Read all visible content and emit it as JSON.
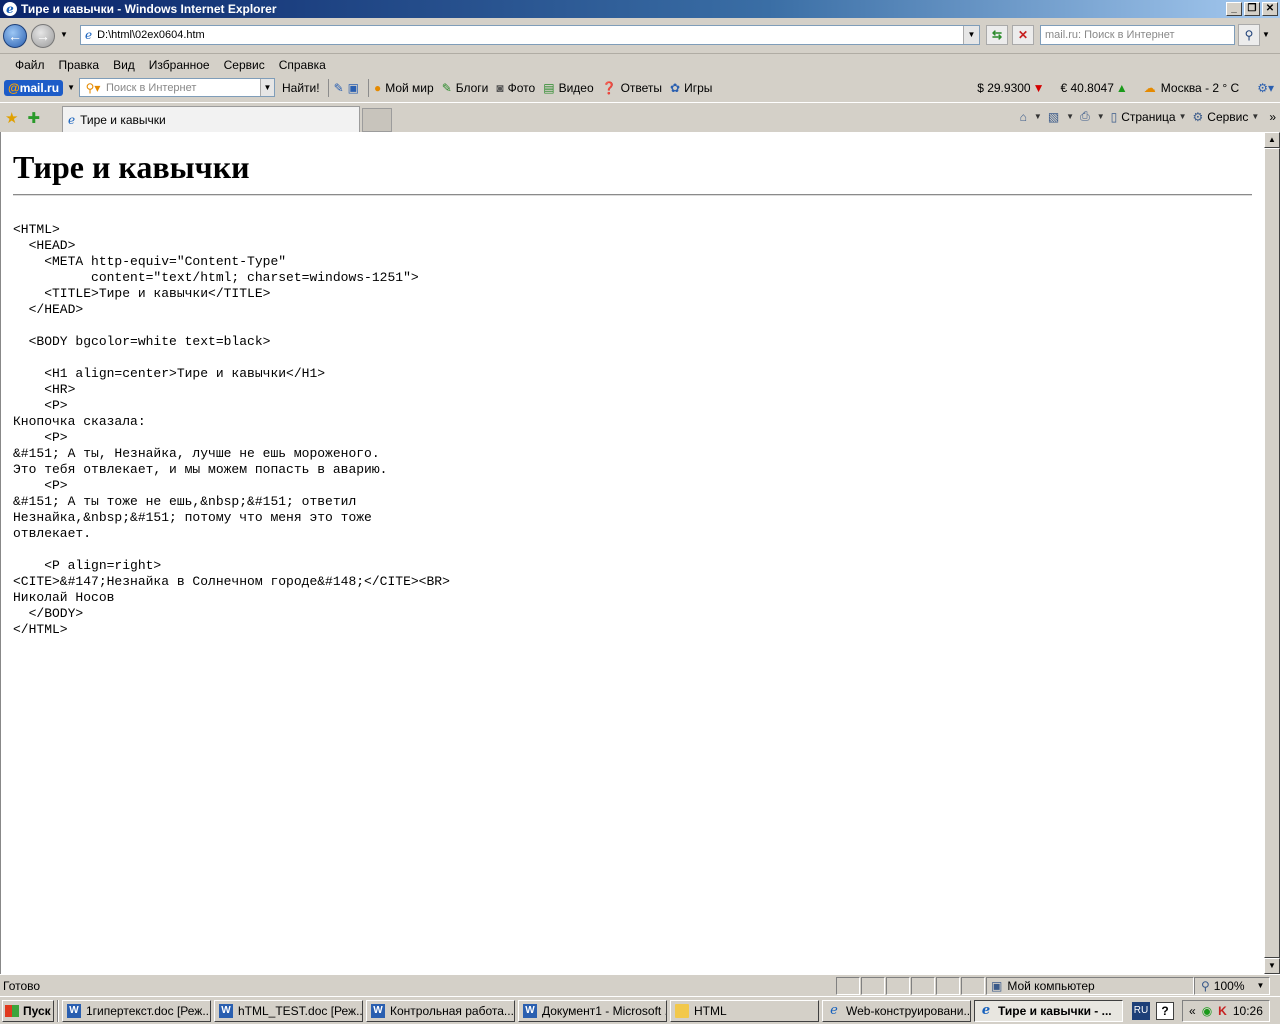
{
  "window": {
    "title": "Тире и кавычки - Windows Internet Explorer",
    "buttons": {
      "minimize": "_",
      "maximize": "❐",
      "close": "✕"
    }
  },
  "address_bar": {
    "url": "D:\\html\\02ex0604.htm",
    "search_placeholder": "mail.ru: Поиск в Интернет"
  },
  "menu": [
    "Файл",
    "Правка",
    "Вид",
    "Избранное",
    "Сервис",
    "Справка"
  ],
  "mailru_toolbar": {
    "logo_prefix": "@",
    "logo_text": "mail.ru",
    "search_placeholder": "Поиск в Интернет",
    "find_label": "Найти!",
    "links": [
      "Мой мир",
      "Блоги",
      "Фото",
      "Видео",
      "Ответы",
      "Игры"
    ],
    "usd_rate": "$ 29.9300",
    "eur_rate": "€ 40.8047",
    "weather": "Москва  - 2 ° C"
  },
  "tabs": [
    {
      "label": "Тире и кавычки",
      "active": true
    }
  ],
  "command_bar": {
    "page_label": "Страница",
    "tools_label": "Сервис"
  },
  "page": {
    "heading": "Тире и кавычки",
    "source": "<HTML>\n  <HEAD>\n    <META http-equiv=\"Content-Type\"\n          content=\"text/html; charset=windows-1251\">\n    <TITLE>Тире и кавычки</TITLE>\n  </HEAD>\n\n  <BODY bgcolor=white text=black>\n\n    <H1 align=center>Тире и кавычки</H1>\n    <HR>\n    <P>\nКнопочка сказала:\n    <P>\n&#151; А ты, Незнайка, лучше не ешь мороженого.\nЭто тебя отвлекает, и мы можем попасть в аварию.\n    <P>\n&#151; А ты тоже не ешь,&nbsp;&#151; ответил\nНезнайка,&nbsp;&#151; потому что меня это тоже\nотвлекает.\n\n    <P align=right>\n<CITE>&#147;Незнайка в Солнечном городе&#148;</CITE><BR>\nНиколай Носов\n  </BODY>\n</HTML>"
  },
  "status_bar": {
    "text": "Готово",
    "zone": "Мой компьютер",
    "zoom": "100%"
  },
  "taskbar": {
    "start_label": "Пуск",
    "tasks": [
      {
        "label": "1гипертекст.doc [Реж...",
        "icon": "word",
        "active": false
      },
      {
        "label": "hTML_TEST.doc [Реж...",
        "icon": "word",
        "active": false
      },
      {
        "label": "Контрольная работа...",
        "icon": "word",
        "active": false
      },
      {
        "label": "Документ1 - Microsoft ...",
        "icon": "word",
        "active": false
      },
      {
        "label": "HTML",
        "icon": "folder",
        "active": false
      },
      {
        "label": "Web-конструировани...",
        "icon": "ie",
        "active": false
      },
      {
        "label": "Тире и кавычки - ...",
        "icon": "ie",
        "active": true
      }
    ],
    "lang": "RU",
    "clock": "10:26",
    "tray_prefix": "«"
  }
}
